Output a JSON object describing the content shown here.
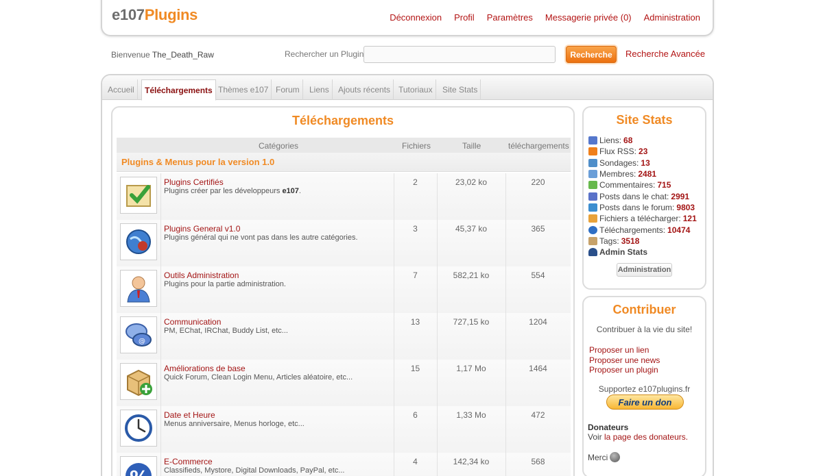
{
  "header": {
    "logo_part1": "e107",
    "logo_part2": "Plugins",
    "nav": [
      "Déconnexion",
      "Profil",
      "Paramètres",
      "Messagerie privée (0)",
      "Administration"
    ]
  },
  "searchbar": {
    "welcome": "Bienvenue",
    "username": "The_Death_Raw",
    "label": "Rechercher un Plugin:",
    "input_value": "",
    "button": "Recherche",
    "advanced": "Recherche Avancée"
  },
  "tabs": [
    "Accueil",
    "Téléchargements",
    "Thèmes e107",
    "Forum",
    "Liens",
    "Ajouts récents",
    "Tutoriaux",
    "Site Stats"
  ],
  "active_tab": "Téléchargements",
  "main": {
    "title": "Téléchargements",
    "columns": [
      "Catégories",
      "Fichiers",
      "Taille",
      "téléchargements"
    ],
    "section": "Plugins & Menus pour la version 1.0",
    "rows": [
      {
        "name": "Plugins Certifiés",
        "desc": "Plugins créer par les développeurs ",
        "desc_bold": "e107",
        "desc_end": ".",
        "files": "2",
        "size": "23,02 ko",
        "downloads": "220",
        "icon": "certified-check-icon"
      },
      {
        "name": "Plugins General v1.0",
        "desc": "Plugins général qui ne vont pas dans les autre catégories.",
        "desc_bold": "",
        "desc_end": "",
        "files": "3",
        "size": "45,37 ko",
        "downloads": "365",
        "icon": "globe-plugin-icon"
      },
      {
        "name": "Outils Administration",
        "desc": "Plugins pour la partie administration.",
        "desc_bold": "",
        "desc_end": "",
        "files": "7",
        "size": "582,21 ko",
        "downloads": "554",
        "icon": "admin-user-icon"
      },
      {
        "name": "Communication",
        "desc": "PM, EChat, IRChat, Buddy List, etc...",
        "desc_bold": "",
        "desc_end": "",
        "files": "13",
        "size": "727,15 ko",
        "downloads": "1204",
        "icon": "chat-bubbles-icon"
      },
      {
        "name": "Améliorations de base",
        "desc": "Quick Forum, Clean Login Menu, Articles aléatoire, etc...",
        "desc_bold": "",
        "desc_end": "",
        "files": "15",
        "size": "1,17 Mo",
        "downloads": "1464",
        "icon": "package-add-icon"
      },
      {
        "name": "Date et Heure",
        "desc": "Menus anniversaire, Menus horloge, etc...",
        "desc_bold": "",
        "desc_end": "",
        "files": "6",
        "size": "1,33 Mo",
        "downloads": "472",
        "icon": "clock-icon"
      },
      {
        "name": "E-Commerce",
        "desc": "Classifieds, Mystore, Digital Downloads, PayPal, etc...",
        "desc_bold": "",
        "desc_end": "",
        "files": "4",
        "size": "142,34 ko",
        "downloads": "568",
        "icon": "percent-icon"
      }
    ]
  },
  "stats": {
    "title": "Site Stats",
    "items": [
      {
        "label": "Liens:",
        "value": "68",
        "icon": "links-icon",
        "color": "#5577cc"
      },
      {
        "label": "Flux RSS:",
        "value": "23",
        "icon": "rss-icon",
        "color": "#f07f1a"
      },
      {
        "label": "Sondages:",
        "value": "13",
        "icon": "poll-icon",
        "color": "#4f8ec9"
      },
      {
        "label": "Membres:",
        "value": "2481",
        "icon": "members-icon",
        "color": "#6a9ed8"
      },
      {
        "label": "Commentaires:",
        "value": "715",
        "icon": "comments-icon",
        "color": "#67b94d"
      },
      {
        "label": "Posts dans le chat:",
        "value": "2991",
        "icon": "chat-icon",
        "color": "#5a72c9"
      },
      {
        "label": "Posts dans le forum:",
        "value": "9803",
        "icon": "forum-icon",
        "color": "#3c8ed0"
      },
      {
        "label": "Fichiers a télécharger:",
        "value": "121",
        "icon": "files-icon",
        "color": "#e8a23a"
      },
      {
        "label": "Téléchargements:",
        "value": "10474",
        "icon": "info-icon",
        "color": "#2f6fc4"
      },
      {
        "label": "Tags:",
        "value": "3518",
        "icon": "tags-icon",
        "color": "#c7a26a"
      }
    ],
    "admin_stats": "Admin Stats",
    "admin_button": "Administration"
  },
  "contrib": {
    "title": "Contribuer",
    "intro": "Contribuer à la vie du site!",
    "links": [
      "Proposer un lien",
      "Proposer une news",
      "Proposer un plugin"
    ],
    "support": "Supportez e107plugins.fr",
    "donate": "Faire un don",
    "donateurs": "Donateurs",
    "voir_prefix": "Voir ",
    "voir_link": "la page des donateurs.",
    "merci": "Merci"
  }
}
